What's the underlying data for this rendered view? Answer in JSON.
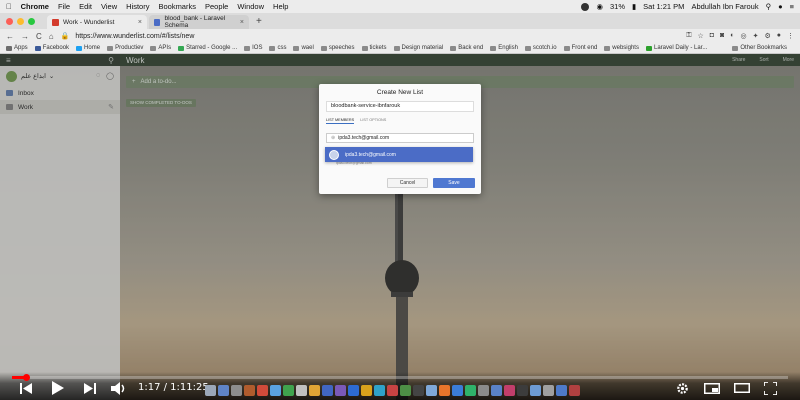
{
  "menubar": {
    "apple": "",
    "items": [
      "Chrome",
      "File",
      "Edit",
      "View",
      "History",
      "Bookmarks",
      "People",
      "Window",
      "Help"
    ],
    "battery": "31%",
    "datetime": "Sat 1:21 PM",
    "user": "Abdullah Ibn Farouk"
  },
  "tabs": [
    {
      "title": "Work - Wunderlist",
      "favicon_color": "#d33b2c"
    },
    {
      "title": "blood_bank - Laravel Schema",
      "favicon_color": "#4b6cc6"
    }
  ],
  "address": {
    "url": "https://www.wunderlist.com/#/lists/new"
  },
  "bookmarks": {
    "items": [
      "Apps",
      "Facebook",
      "Home",
      "Productiev",
      "APIs",
      "Starred - Google ...",
      "IOS",
      "css",
      "wael",
      "speeches",
      "tickets",
      "Design material",
      "Back end",
      "English",
      "scotch.io",
      "Front end",
      "websights",
      "Laravel Daily - Lar..."
    ],
    "other": "Other Bookmarks"
  },
  "sidebar": {
    "user_name": "ابداع علم",
    "items": [
      {
        "label": "Inbox"
      },
      {
        "label": "Work"
      }
    ]
  },
  "main": {
    "title": "Work",
    "header_icons": [
      "Share",
      "Sort",
      "More"
    ],
    "add_placeholder": "Add a to-do...",
    "show_completed": "SHOW COMPLETED TO-DOS"
  },
  "modal": {
    "title": "Create New List",
    "list_name": "bloodbank-service-ibnfarouk",
    "tabs": [
      "LIST MEMBERS",
      "LIST OPTIONS"
    ],
    "member_input": "ipda3.tech@gmail.com",
    "suggestion": "ipda3.tech@gmail.com",
    "member_below": "ipda3.tech@gmail.com",
    "cancel": "Cancel",
    "save": "Save"
  },
  "video": {
    "time": "1:17 / 1:11:25",
    "progress": 0.018
  }
}
